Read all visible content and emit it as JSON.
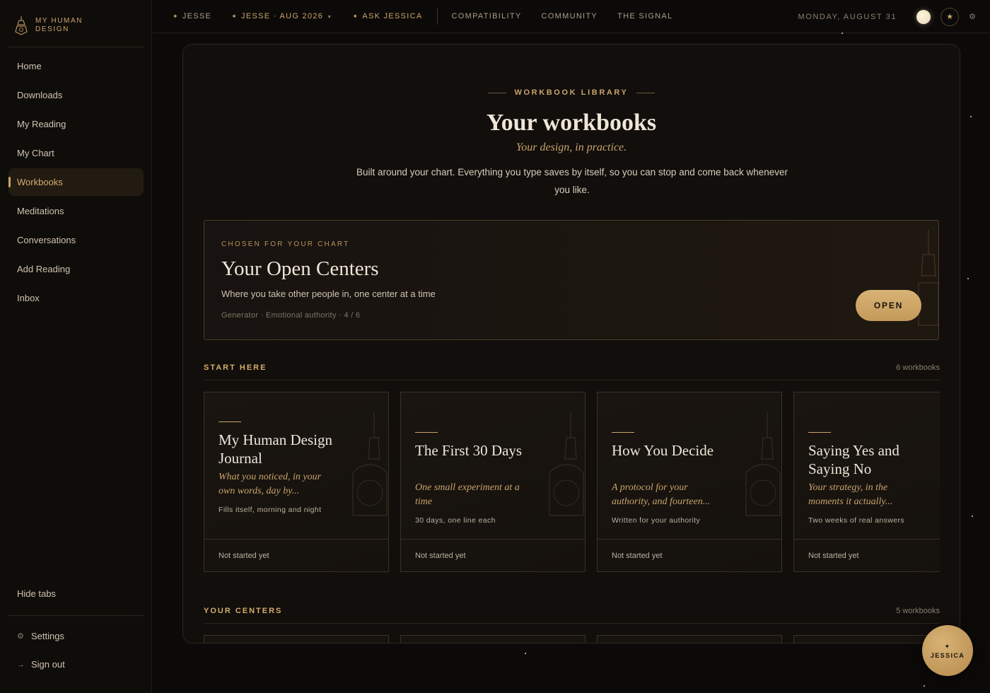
{
  "brand": {
    "name": "MY HUMAN DESIGN"
  },
  "sidebar": {
    "items": [
      {
        "label": "Home",
        "active": false
      },
      {
        "label": "Downloads",
        "active": false
      },
      {
        "label": "My Reading",
        "active": false
      },
      {
        "label": "My Chart",
        "active": false
      },
      {
        "label": "Workbooks",
        "active": true
      },
      {
        "label": "Meditations",
        "active": false
      },
      {
        "label": "Conversations",
        "active": false
      },
      {
        "label": "Add Reading",
        "active": false
      },
      {
        "label": "Inbox",
        "active": false
      }
    ],
    "hide_tabs": "Hide tabs",
    "settings": "Settings",
    "sign_out": "Sign out"
  },
  "topbar": {
    "profile": "JESSE",
    "transit": "JESSE · AUG 2026",
    "ask": "ASK JESSICA",
    "compatibility": "COMPATIBILITY",
    "community": "COMMUNITY",
    "signal": "THE SIGNAL",
    "date": "MONDAY, AUGUST 31"
  },
  "header": {
    "eyebrow": "WORKBOOK LIBRARY",
    "title": "Your workbooks",
    "subtitle": "Your design, in practice.",
    "description": "Built around your chart. Everything you type saves by itself, so you can stop and come back whenever you like."
  },
  "featured": {
    "kicker": "CHOSEN FOR YOUR CHART",
    "title": "Your Open Centers",
    "subtitle": "Where you take other people in, one center at a time",
    "meta": "Generator · Emotional authority · 4 / 6",
    "button": "OPEN"
  },
  "sections": {
    "start": {
      "label": "START HERE",
      "count": "6 workbooks"
    },
    "centers": {
      "label": "YOUR CENTERS",
      "count": "5 workbooks"
    }
  },
  "cards": [
    {
      "title": "My Human Design Journal",
      "subtitle": "What you noticed, in your own words, day by...",
      "note": "Fills itself, morning and night",
      "status": "Not started yet"
    },
    {
      "title": "The First 30 Days",
      "subtitle": "One small experiment at a time",
      "note": "30 days, one line each",
      "status": "Not started yet"
    },
    {
      "title": "How You Decide",
      "subtitle": "A protocol for your authority, and fourteen...",
      "note": "Written for your authority",
      "status": "Not started yet"
    },
    {
      "title": "Saying Yes and Saying No",
      "subtitle": "Your strategy, in the moments it actually...",
      "note": "Two weeks of real answers",
      "status": "Not started yet"
    }
  ],
  "assistant": {
    "label": "JESSICA"
  },
  "colors": {
    "accent": "#c9a46b",
    "background": "#0c0a08",
    "panel": "#110e0b"
  }
}
